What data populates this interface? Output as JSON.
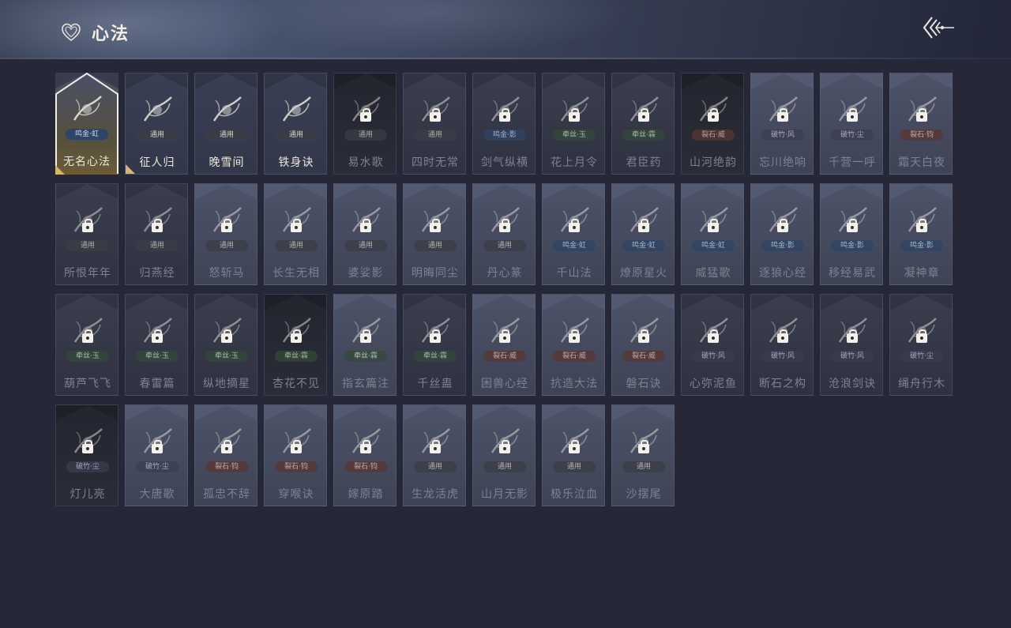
{
  "header": {
    "title": "心法",
    "title_icon": "heart-icon",
    "back_icon": "back-arrow-icon"
  },
  "colors": {
    "background": "#262837",
    "badge_general": "#3b3d46",
    "badge_mj": "#2d4566",
    "badge_rs": "#34493a",
    "badge_ls": "#5a3533",
    "badge_pz": "#3c3d50",
    "selected_gold": "#d9b56a"
  },
  "skills": [
    {
      "name": "无名心法",
      "badge": "鸣金·虹",
      "badge_type": "mj",
      "state": "selected",
      "icon": "sword-flute-icon",
      "corner_flag": true
    },
    {
      "name": "征人归",
      "badge": "通用",
      "badge_type": "general",
      "state": "lit",
      "icon": "eagle-icon",
      "corner_flag": true
    },
    {
      "name": "晚雪间",
      "badge": "通用",
      "badge_type": "general",
      "state": "lit",
      "icon": "anchor-cross-icon"
    },
    {
      "name": "铁身诀",
      "badge": "通用",
      "badge_type": "general",
      "state": "lit",
      "icon": "muscle-icon"
    },
    {
      "name": "易水歌",
      "badge": "通用",
      "badge_type": "general",
      "state": "dark",
      "icon": "horse-icon"
    },
    {
      "name": "四时无常",
      "badge": "通用",
      "badge_type": "general",
      "state": "dim",
      "icon": "swirl-icon"
    },
    {
      "name": "剑气纵横",
      "badge": "鸣金·影",
      "badge_type": "mj",
      "state": "dim",
      "icon": "sword-slash-icon"
    },
    {
      "name": "花上月令",
      "badge": "牵丝·玉",
      "badge_type": "rs",
      "state": "dim",
      "icon": "flower-moon-icon"
    },
    {
      "name": "君臣药",
      "badge": "牵丝·霖",
      "badge_type": "rs",
      "state": "dim",
      "icon": "herb-icon"
    },
    {
      "name": "山河绝韵",
      "badge": "裂石·威",
      "badge_type": "ls",
      "state": "dark",
      "icon": "mountain-icon"
    },
    {
      "name": "忘川绝响",
      "badge": "破竹·风",
      "badge_type": "pz",
      "state": "light",
      "icon": "flame-icon"
    },
    {
      "name": "千营一呼",
      "badge": "破竹·尘",
      "badge_type": "pz",
      "state": "light",
      "icon": "banner-icon"
    },
    {
      "name": "霜天白夜",
      "badge": "裂石·钧",
      "badge_type": "ls",
      "state": "light",
      "icon": "blade-ground-icon"
    },
    {
      "name": "所恨年年",
      "badge": "通用",
      "badge_type": "general",
      "state": "dim",
      "icon": "branch-icon"
    },
    {
      "name": "归燕经",
      "badge": "通用",
      "badge_type": "general",
      "state": "dim",
      "icon": "swallow-icon"
    },
    {
      "name": "怒斩马",
      "badge": "通用",
      "badge_type": "general",
      "state": "light",
      "icon": "slash-horse-icon"
    },
    {
      "name": "长生无相",
      "badge": "通用",
      "badge_type": "general",
      "state": "light",
      "icon": "pagoda-icon"
    },
    {
      "name": "婆娑影",
      "badge": "通用",
      "badge_type": "general",
      "state": "light",
      "icon": "dragon-icon"
    },
    {
      "name": "明晦同尘",
      "badge": "通用",
      "badge_type": "general",
      "state": "light",
      "icon": "serpent-icon"
    },
    {
      "name": "丹心篆",
      "badge": "通用",
      "badge_type": "general",
      "state": "light",
      "icon": "sword-stone-icon"
    },
    {
      "name": "千山法",
      "badge": "鸣金·虹",
      "badge_type": "mj",
      "state": "light",
      "icon": "peaks-icon"
    },
    {
      "name": "燎原星火",
      "badge": "鸣金·虹",
      "badge_type": "mj",
      "state": "light",
      "icon": "comet-icon"
    },
    {
      "name": "威猛歌",
      "badge": "鸣金·虹",
      "badge_type": "mj",
      "state": "light",
      "icon": "fist-icon"
    },
    {
      "name": "逐狼心经",
      "badge": "鸣金·影",
      "badge_type": "mj",
      "state": "light",
      "icon": "wolf-icon"
    },
    {
      "name": "移经易武",
      "badge": "鸣金·影",
      "badge_type": "mj",
      "state": "light",
      "icon": "warrior-icon"
    },
    {
      "name": "凝神章",
      "badge": "鸣金·影",
      "badge_type": "mj",
      "state": "light",
      "icon": "bow-icon"
    },
    {
      "name": "葫芦飞飞",
      "badge": "牵丝·玉",
      "badge_type": "rs",
      "state": "dim",
      "icon": "gourd-icon"
    },
    {
      "name": "春雷篇",
      "badge": "牵丝·玉",
      "badge_type": "rs",
      "state": "dim",
      "icon": "tree-icon"
    },
    {
      "name": "纵地摘星",
      "badge": "牵丝·玉",
      "badge_type": "rs",
      "state": "dim",
      "icon": "star-ring-icon"
    },
    {
      "name": "杏花不见",
      "badge": "牵丝·霖",
      "badge_type": "rs",
      "state": "dark",
      "icon": "blossom-icon"
    },
    {
      "name": "指玄篇注",
      "badge": "牵丝·霖",
      "badge_type": "rs",
      "state": "light",
      "icon": "yinyang-icon"
    },
    {
      "name": "千丝蛊",
      "badge": "牵丝·霖",
      "badge_type": "rs",
      "state": "dim",
      "icon": "leaf-icon"
    },
    {
      "name": "困兽心经",
      "badge": "裂石·威",
      "badge_type": "ls",
      "state": "light",
      "icon": "beast-icon"
    },
    {
      "name": "抗造大法",
      "badge": "裂石·威",
      "badge_type": "ls",
      "state": "light",
      "icon": "bell-icon"
    },
    {
      "name": "磐石诀",
      "badge": "裂石·威",
      "badge_type": "ls",
      "state": "light",
      "icon": "boulder-icon"
    },
    {
      "name": "心弥泥鱼",
      "badge": "破竹·风",
      "badge_type": "pz",
      "state": "dim",
      "icon": "fish-icon"
    },
    {
      "name": "断石之构",
      "badge": "破竹·风",
      "badge_type": "pz",
      "state": "dim",
      "icon": "swordsman-icon"
    },
    {
      "name": "沧浪剑诀",
      "badge": "破竹·风",
      "badge_type": "pz",
      "state": "dim",
      "icon": "wave-sword-icon"
    },
    {
      "name": "绳舟行木",
      "badge": "破竹·尘",
      "badge_type": "pz",
      "state": "dim",
      "icon": "boat-icon"
    },
    {
      "name": "灯儿亮",
      "badge": "破竹·尘",
      "badge_type": "pz",
      "state": "dark",
      "icon": "lantern-icon"
    },
    {
      "name": "大唐歌",
      "badge": "破竹·尘",
      "badge_type": "pz",
      "state": "light",
      "icon": "palace-icon"
    },
    {
      "name": "孤忠不辞",
      "badge": "裂石·钧",
      "badge_type": "ls",
      "state": "light",
      "icon": "cross-blades-icon"
    },
    {
      "name": "穿喉诀",
      "badge": "裂石·钧",
      "badge_type": "ls",
      "state": "light",
      "icon": "mask-icon"
    },
    {
      "name": "嫁原踏",
      "badge": "裂石·钧",
      "badge_type": "ls",
      "state": "light",
      "icon": "kick-icon"
    },
    {
      "name": "生龙活虎",
      "badge": "通用",
      "badge_type": "general",
      "state": "light",
      "icon": "tiger-icon"
    },
    {
      "name": "山月无影",
      "badge": "通用",
      "badge_type": "general",
      "state": "light",
      "icon": "crescent-blade-icon"
    },
    {
      "name": "极乐泣血",
      "badge": "通用",
      "badge_type": "general",
      "state": "light",
      "icon": "claw-icon"
    },
    {
      "name": "沙摆尾",
      "badge": "通用",
      "badge_type": "general",
      "state": "light",
      "icon": "tail-swirl-icon"
    }
  ]
}
